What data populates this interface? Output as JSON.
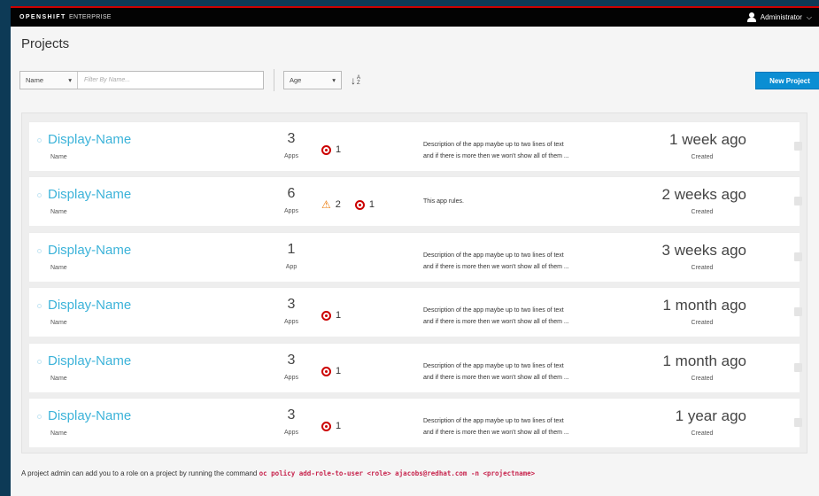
{
  "brand": {
    "name": "OPENSHIFT",
    "edition": "ENTERPRISE"
  },
  "user": {
    "name": "Administrator",
    "caret": "⌵"
  },
  "page_title": "Projects",
  "filter": {
    "field": "Name",
    "placeholder": "Filter By Name..."
  },
  "sort": {
    "field": "Age"
  },
  "new_project_label": "New Project",
  "projects": [
    {
      "name": "Display-Name",
      "sub": "Name",
      "count": "3",
      "count_label": "Apps",
      "warnings": "",
      "errors": "1",
      "desc1": "Description of the app maybe up to two lines of text",
      "desc2": "and if there is more then we won't show all of them ...",
      "time": "1 week ago",
      "time_label": "Created"
    },
    {
      "name": "Display-Name",
      "sub": "Name",
      "count": "6",
      "count_label": "Apps",
      "warnings": "2",
      "errors": "1",
      "desc1": "This app rules.",
      "desc2": "",
      "time": "2 weeks ago",
      "time_label": "Created"
    },
    {
      "name": "Display-Name",
      "sub": "Name",
      "count": "1",
      "count_label": "App",
      "warnings": "",
      "errors": "",
      "desc1": "Description of the app maybe up to two lines of text",
      "desc2": "and if there is more then we won't show all of them ...",
      "time": "3 weeks ago",
      "time_label": "Created"
    },
    {
      "name": "Display-Name",
      "sub": "Name",
      "count": "3",
      "count_label": "Apps",
      "warnings": "",
      "errors": "1",
      "desc1": "Description of the app maybe up to two lines of text",
      "desc2": "and if there is more then we won't show all of them ...",
      "time": "1 month ago",
      "time_label": "Created"
    },
    {
      "name": "Display-Name",
      "sub": "Name",
      "count": "3",
      "count_label": "Apps",
      "warnings": "",
      "errors": "1",
      "desc1": "Description of the app maybe up to two lines of text",
      "desc2": "and if there is more then we won't show all of them ...",
      "time": "1 month ago",
      "time_label": "Created"
    },
    {
      "name": "Display-Name",
      "sub": "Name",
      "count": "3",
      "count_label": "Apps",
      "warnings": "",
      "errors": "1",
      "desc1": "Description of the app maybe up to two lines of text",
      "desc2": "and if there is more then we won't show all of them ...",
      "time": "1 year ago",
      "time_label": "Created"
    }
  ],
  "footer": {
    "text": "A project admin can add you to a role on a project by running the command",
    "command": "oc policy add-role-to-user <role> ajacobs@redhat.com -n <projectname>"
  },
  "colors": {
    "accent": "#0b8ed3",
    "link": "#3cb3d9",
    "error": "#cc0000",
    "warning": "#ec7a08",
    "masthead": "#030303",
    "outer": "#0d3a56"
  }
}
